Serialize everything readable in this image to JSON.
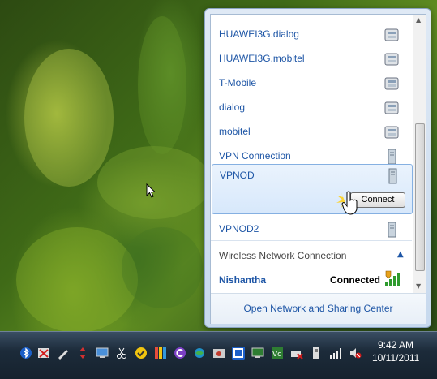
{
  "network_list": [
    {
      "name": "HUAWEI3G.dialog",
      "icon": "dialup-modem-icon"
    },
    {
      "name": "HUAWEI3G.mobitel",
      "icon": "dialup-modem-icon"
    },
    {
      "name": "T-Mobile",
      "icon": "dialup-modem-icon"
    },
    {
      "name": "dialog",
      "icon": "dialup-modem-icon"
    },
    {
      "name": "mobitel",
      "icon": "dialup-modem-icon"
    },
    {
      "name": "VPN Connection",
      "icon": "vpn-server-icon"
    },
    {
      "name": "VPNOD",
      "icon": "vpn-server-icon",
      "selected": true
    },
    {
      "name": "VPNOD2",
      "icon": "vpn-server-icon"
    }
  ],
  "connect_label": "Connect",
  "section_header": "Wireless Network Connection",
  "wireless": {
    "ssid": "Nishantha",
    "status": "Connected"
  },
  "footer_link": "Open Network and Sharing Center",
  "clock": {
    "time": "9:42 AM",
    "date": "10/11/2011"
  },
  "colors": {
    "link_blue": "#1e56a6",
    "selection_border": "#85b0e2",
    "taskbar": "#1c2b3a"
  },
  "tray_icons": [
    "bluetooth-icon",
    "network-error-icon",
    "pen-icon",
    "arrows-icon",
    "monitor-icon",
    "scissors-icon",
    "norton-icon",
    "color-icon",
    "copy-icon",
    "globe-icon",
    "camera-icon",
    "app-icon",
    "display-icon",
    "vector-icon",
    "printer-error-icon",
    "usb-icon",
    "signal-icon",
    "volume-muted-icon"
  ]
}
